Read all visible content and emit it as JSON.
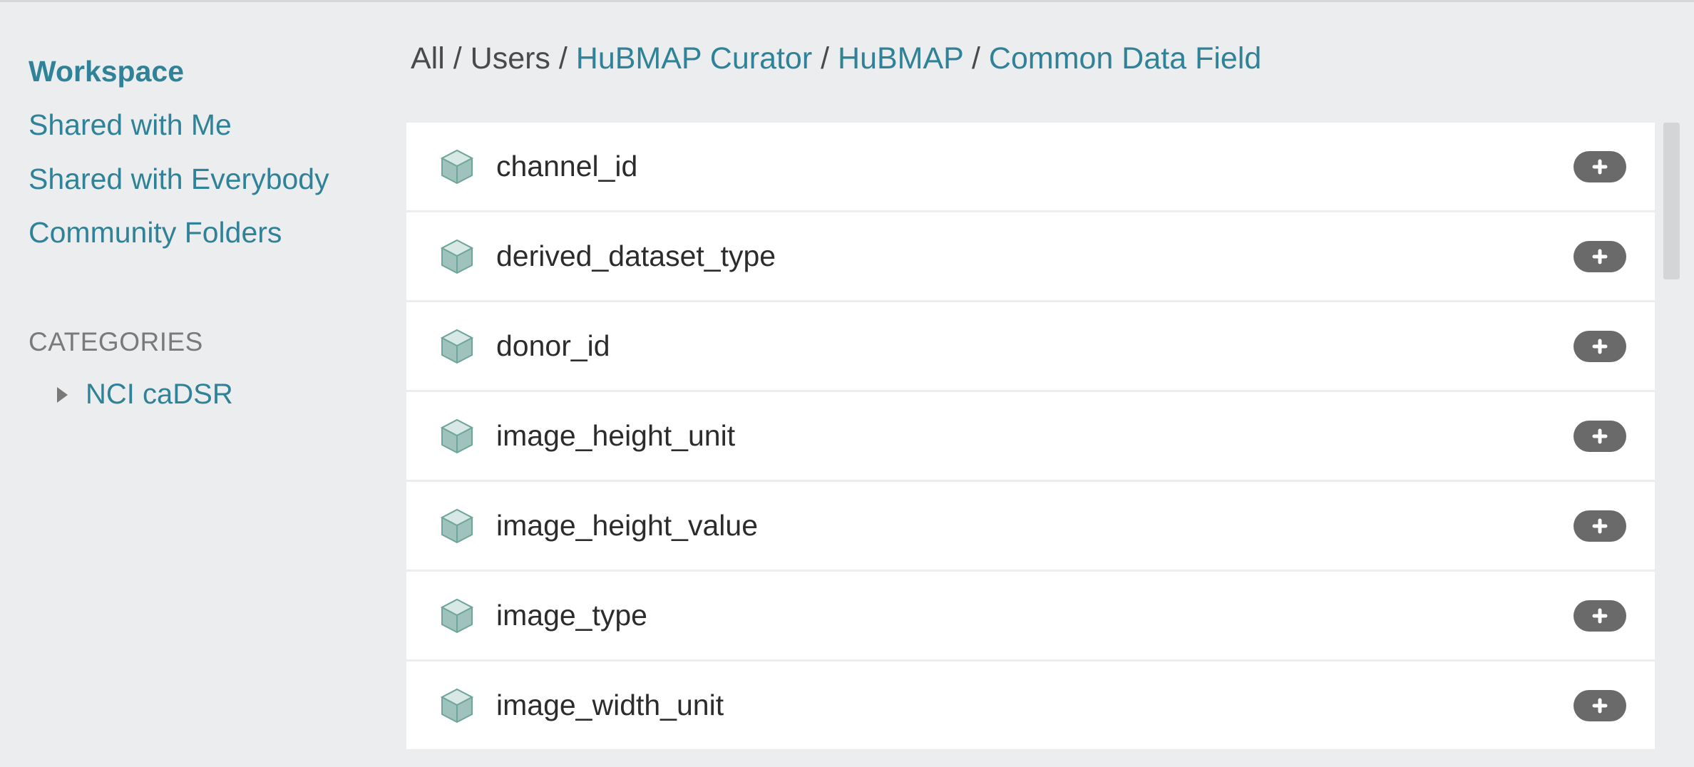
{
  "sidebar": {
    "nav": [
      {
        "label": "Workspace",
        "active": true
      },
      {
        "label": "Shared with Me",
        "active": false
      },
      {
        "label": "Shared with Everybody",
        "active": false
      },
      {
        "label": "Community Folders",
        "active": false
      }
    ],
    "categories_header": "CATEGORIES",
    "categories": [
      {
        "label": "NCI caDSR"
      }
    ]
  },
  "breadcrumb": {
    "parts": [
      {
        "label": "All",
        "link": false
      },
      {
        "label": "Users",
        "link": false
      },
      {
        "label": "HuBMAP Curator",
        "link": true
      },
      {
        "label": "HuBMAP",
        "link": true
      },
      {
        "label": "Common Data Field",
        "link": true
      }
    ],
    "sep": " / "
  },
  "items": [
    {
      "name": "channel_id"
    },
    {
      "name": "derived_dataset_type"
    },
    {
      "name": "donor_id"
    },
    {
      "name": "image_height_unit"
    },
    {
      "name": "image_height_value"
    },
    {
      "name": "image_type"
    },
    {
      "name": "image_width_unit"
    }
  ]
}
